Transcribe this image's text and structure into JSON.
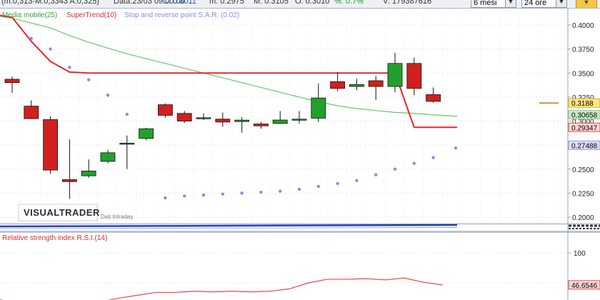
{
  "quote_bar": {
    "ohlc_text": "(m.0,313-M.0,3343 A:0,325)",
    "date_text": "Data:23/03 09:00:00",
    "close_text": "C: 0.3011",
    "min_text": "m: 0.2975",
    "max_text": "M: 0.3105",
    "open_text": "O: 0.3010",
    "pct_text": "%: 0.7%",
    "volume_text": "V: 179387616",
    "period_select": "6 mesi",
    "interval_select": "24 ore"
  },
  "legend": {
    "sma": "Media mobile(25)",
    "supertrend": "SuperTrend(10)",
    "sar": "Stop and reverse point S.A.R. (0.02)"
  },
  "watermark": {
    "brand": "VISUALTRADER",
    "subtitle": "Dati Intraday"
  },
  "rsi_panel": {
    "title": "Relative strength index R.S.I.(14)"
  },
  "colors": {
    "up": "#22a02c",
    "down": "#d21f1f",
    "sma": "#6ec46a",
    "supertrend": "#e8282b",
    "sar": "#8a8ae6",
    "rsi": "#e8484a",
    "volume": "#2040c0"
  },
  "chart_data": [
    {
      "type": "candlestick",
      "ylim": [
        0.19,
        0.41
      ],
      "y_ticks": [
        "0.4000",
        "0.3750",
        "0.3500",
        "0.3250",
        "0.3000",
        "0.2750",
        "0.2500",
        "0.2250",
        "0.2000"
      ],
      "candles": [
        {
          "o": 0.3435,
          "h": 0.3465,
          "l": 0.3295,
          "c": 0.34
        },
        {
          "o": 0.3155,
          "h": 0.3215,
          "l": 0.3035,
          "c": 0.3025
        },
        {
          "o": 0.3015,
          "h": 0.305,
          "l": 0.245,
          "c": 0.249
        },
        {
          "o": 0.239,
          "h": 0.281,
          "l": 0.219,
          "c": 0.237
        },
        {
          "o": 0.243,
          "h": 0.26,
          "l": 0.241,
          "c": 0.248
        },
        {
          "o": 0.258,
          "h": 0.27,
          "l": 0.256,
          "c": 0.267
        },
        {
          "o": 0.277,
          "h": 0.285,
          "l": 0.25,
          "c": 0.277
        },
        {
          "o": 0.282,
          "h": 0.293,
          "l": 0.28,
          "c": 0.292
        },
        {
          "o": 0.317,
          "h": 0.3185,
          "l": 0.3035,
          "c": 0.306
        },
        {
          "o": 0.308,
          "h": 0.3105,
          "l": 0.298,
          "c": 0.3
        },
        {
          "o": 0.303,
          "h": 0.308,
          "l": 0.301,
          "c": 0.3035
        },
        {
          "o": 0.302,
          "h": 0.309,
          "l": 0.294,
          "c": 0.299
        },
        {
          "o": 0.2995,
          "h": 0.304,
          "l": 0.288,
          "c": 0.301
        },
        {
          "o": 0.297,
          "h": 0.299,
          "l": 0.292,
          "c": 0.295
        },
        {
          "o": 0.2975,
          "h": 0.3105,
          "l": 0.297,
          "c": 0.3011
        },
        {
          "o": 0.301,
          "h": 0.3105,
          "l": 0.2975,
          "c": 0.302
        },
        {
          "o": 0.303,
          "h": 0.339,
          "l": 0.299,
          "c": 0.324
        },
        {
          "o": 0.341,
          "h": 0.351,
          "l": 0.331,
          "c": 0.334
        },
        {
          "o": 0.336,
          "h": 0.344,
          "l": 0.332,
          "c": 0.338
        },
        {
          "o": 0.342,
          "h": 0.347,
          "l": 0.322,
          "c": 0.336
        },
        {
          "o": 0.336,
          "h": 0.371,
          "l": 0.33,
          "c": 0.36
        },
        {
          "o": 0.36,
          "h": 0.366,
          "l": 0.327,
          "c": 0.334
        },
        {
          "o": 0.3275,
          "h": 0.335,
          "l": 0.319,
          "c": 0.3205
        }
      ],
      "sma": [
        0.407,
        0.402,
        0.397,
        0.389,
        0.382,
        0.376,
        0.37,
        0.365,
        0.36,
        0.355,
        0.35,
        0.345,
        0.34,
        0.335,
        0.33,
        0.325,
        0.32,
        0.316,
        0.313,
        0.311,
        0.309,
        0.308,
        0.3065
      ],
      "supertrend": [
        0.408,
        0.383,
        0.362,
        0.351,
        0.35,
        0.35,
        0.35,
        0.35,
        0.35,
        0.35,
        0.35,
        0.35,
        0.35,
        0.35,
        0.35,
        0.35,
        0.35,
        0.35,
        0.35,
        0.35,
        0.35,
        0.2935,
        0.2935
      ],
      "sar": [
        null,
        0.386,
        0.375,
        0.356,
        0.343,
        0.327,
        0.307,
        0.291,
        0.22,
        0.222,
        0.223,
        0.224,
        0.225,
        0.226,
        0.227,
        0.229,
        0.232,
        0.235,
        0.238,
        0.244,
        0.25,
        0.256,
        0.262,
        0.272
      ],
      "axis_labels": [
        {
          "text": "0.3188",
          "y": 0.3188,
          "bg": "#ffe680",
          "border": "#d2a400",
          "color": "#000"
        },
        {
          "text": "0.30658",
          "y": 0.30658,
          "bg": "#c7ecc5",
          "border": "#6ec46a",
          "color": "#000"
        },
        {
          "text": "0.29347",
          "y": 0.29347,
          "bg": "#ffd6d6",
          "border": "#e8282b",
          "color": "#000"
        },
        {
          "text": "0.27488",
          "y": 0.27488,
          "bg": "#dcdcf8",
          "border": "#8a8ae6",
          "color": "#000"
        }
      ]
    },
    {
      "type": "line",
      "title": "Relative strength index R.S.I.(14)",
      "ylim": [
        0,
        100
      ],
      "y_ticks": [
        "100",
        "50"
      ],
      "values": [
        22,
        12,
        8,
        5,
        9,
        17,
        24,
        29,
        34,
        34,
        36,
        35,
        36,
        35,
        36,
        40,
        50,
        56,
        56,
        57,
        55,
        58,
        51,
        46.6
      ],
      "last_label": "46.6546"
    }
  ]
}
